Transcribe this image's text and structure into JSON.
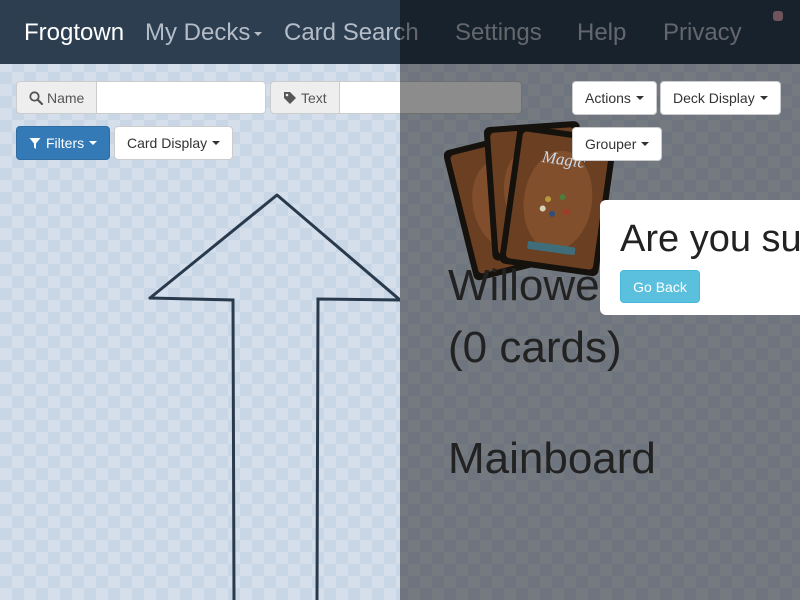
{
  "navbar": {
    "brand": "Frogtown",
    "items": [
      "My Decks",
      "Card Search",
      "Settings",
      "Help",
      "Privacy"
    ]
  },
  "toolbar": {
    "name_label": "Name",
    "name_value": "",
    "text_label": "Text",
    "text_value": "",
    "filters_label": "Filters",
    "card_display_label": "Card Display",
    "actions_label": "Actions",
    "deck_display_label": "Deck Display",
    "grouper_label": "Grouper"
  },
  "deck": {
    "name_line": "Willowe",
    "count_line": "(0 cards)",
    "board_label": "Mainboard"
  },
  "confirm": {
    "text": "Are you sur",
    "go_back_label": "Go Back"
  },
  "card_back": {
    "wordmark": "Magic"
  },
  "colors": {
    "navbar": "#2c3e50",
    "primary": "#337ab7",
    "info": "#5bc0de",
    "card_back": "#6b3f22"
  }
}
